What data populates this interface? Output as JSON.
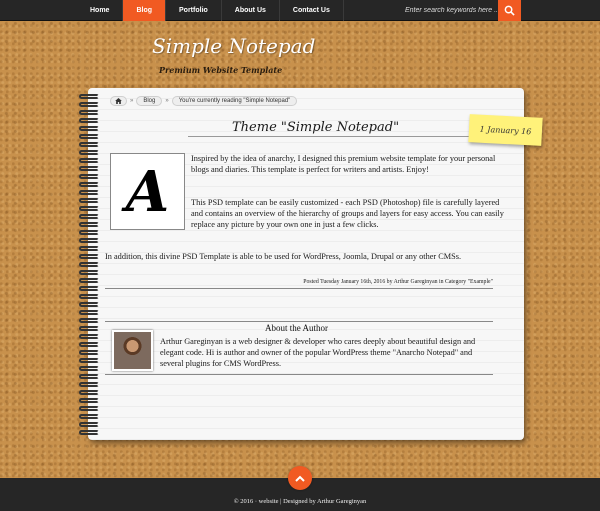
{
  "nav": {
    "items": [
      "Home",
      "Blog",
      "Portfolio",
      "About Us",
      "Contact Us"
    ],
    "active_index": 1
  },
  "search": {
    "placeholder": "Enter search keywords here ...",
    "icon": "search-icon"
  },
  "logo": {
    "title": "Simple Notepad",
    "subtitle": "Premium Website Template"
  },
  "breadcrumb": {
    "home_icon": "home-icon",
    "items": [
      "Blog",
      "You're currently reading \"Simple Notepad\""
    ]
  },
  "post": {
    "title": "Theme \"Simple Notepad\"",
    "date": "1 January 16",
    "dropcap": "A",
    "paragraph1": "Inspired by the idea of anarchy, I designed this premium website template for your personal blogs and diaries. This template is perfect for writers and artists. Enjoy!",
    "paragraph2": "This PSD template can be easily customized - each PSD (Photoshop) file is carefully layered and contains an overview of the hierarchy of groups and layers for easy access. You can easily replace any picture by your own one in just a few clicks.",
    "paragraph3": "In addition, this divine PSD Template is able to be used for WordPress, Joomla, Drupal or any other CMSs.",
    "meta": "Posted Tuesday January 16th, 2016 by Arthur Gareginyan in Category \"Example\""
  },
  "author": {
    "heading": "About the Author",
    "bio": "Arthur Gareginyan is a web designer & developer who cares deeply about beautiful design and elegant code. Hi is author and owner of the popular WordPress theme \"Anarcho Notepad\" and several plugins for CMS WordPress."
  },
  "footer": {
    "text": "© 2016 · website | Designed by Arthur Gareginyan"
  },
  "colors": {
    "accent": "#f15a22",
    "bar": "#262626",
    "cork": "#c8914c",
    "sticky": "#fff27a"
  }
}
